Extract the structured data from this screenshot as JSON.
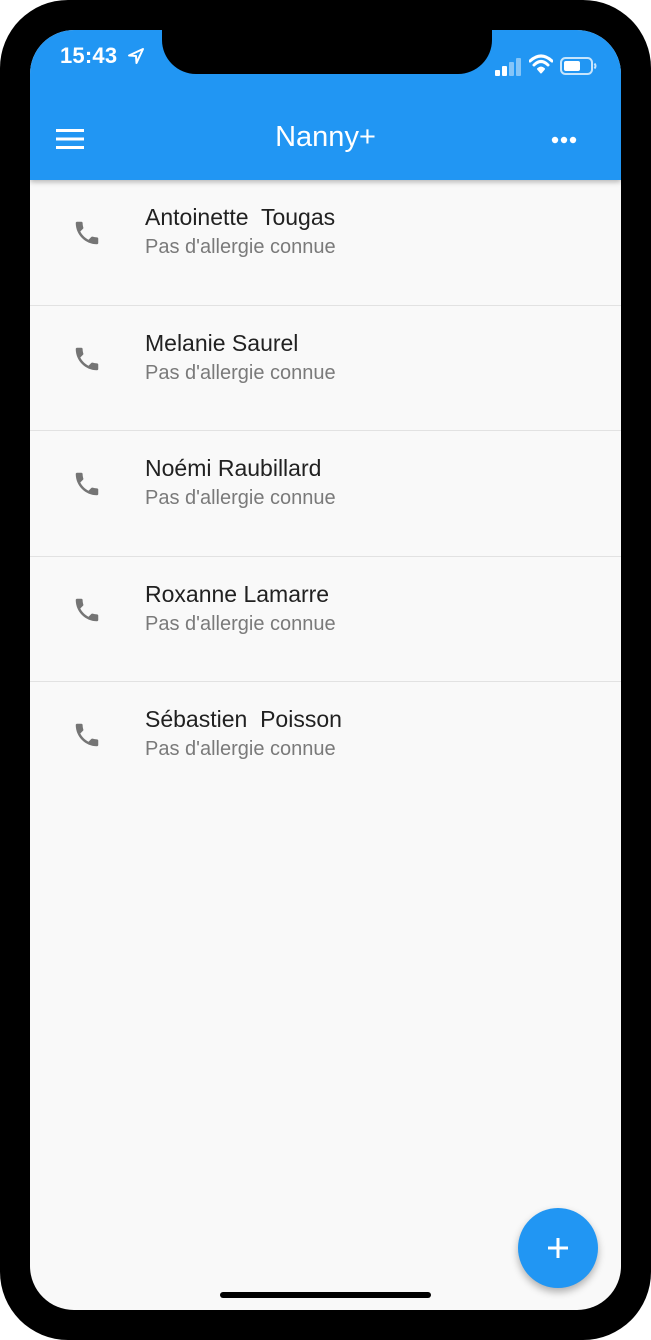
{
  "status_bar": {
    "time": "15:43",
    "icons": [
      "location-icon",
      "cellular-signal-icon",
      "wifi-icon",
      "battery-icon"
    ]
  },
  "app_bar": {
    "title": "Nanny+",
    "left_icon": "menu-icon",
    "right_icon": "more-horizontal-icon",
    "color": "#2196F3"
  },
  "contacts": [
    {
      "name": "Antoinette  Tougas",
      "subtitle": "Pas d'allergie connue",
      "icon": "phone-icon"
    },
    {
      "name": "Melanie Saurel",
      "subtitle": "Pas d'allergie connue",
      "icon": "phone-icon"
    },
    {
      "name": "Noémi Raubillard",
      "subtitle": "Pas d'allergie connue",
      "icon": "phone-icon"
    },
    {
      "name": "Roxanne Lamarre",
      "subtitle": "Pas d'allergie connue",
      "icon": "phone-icon"
    },
    {
      "name": "Sébastien  Poisson",
      "subtitle": "Pas d'allergie connue",
      "icon": "phone-icon"
    }
  ],
  "fab": {
    "icon": "add-icon",
    "color": "#2196F3"
  },
  "colors": {
    "primary": "#2196F3",
    "background": "#F9F9F9",
    "text_primary": "#212121",
    "text_secondary": "#7A7A7A",
    "icon_gray": "#757575"
  }
}
